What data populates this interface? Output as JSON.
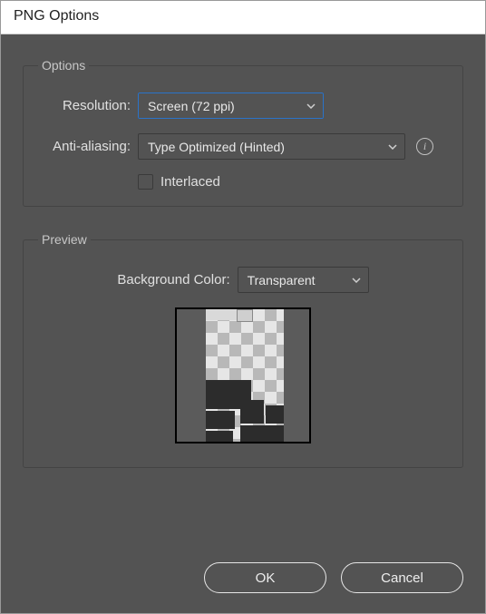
{
  "dialog": {
    "title": "PNG Options"
  },
  "options": {
    "legend": "Options",
    "resolution_label": "Resolution:",
    "resolution_value": "Screen (72 ppi)",
    "antialiasing_label": "Anti-aliasing:",
    "antialiasing_value": "Type Optimized (Hinted)",
    "interlaced_label": "Interlaced",
    "interlaced_checked": false
  },
  "preview": {
    "legend": "Preview",
    "bgcolor_label": "Background Color:",
    "bgcolor_value": "Transparent"
  },
  "buttons": {
    "ok": "OK",
    "cancel": "Cancel"
  },
  "icons": {
    "info": "i"
  }
}
